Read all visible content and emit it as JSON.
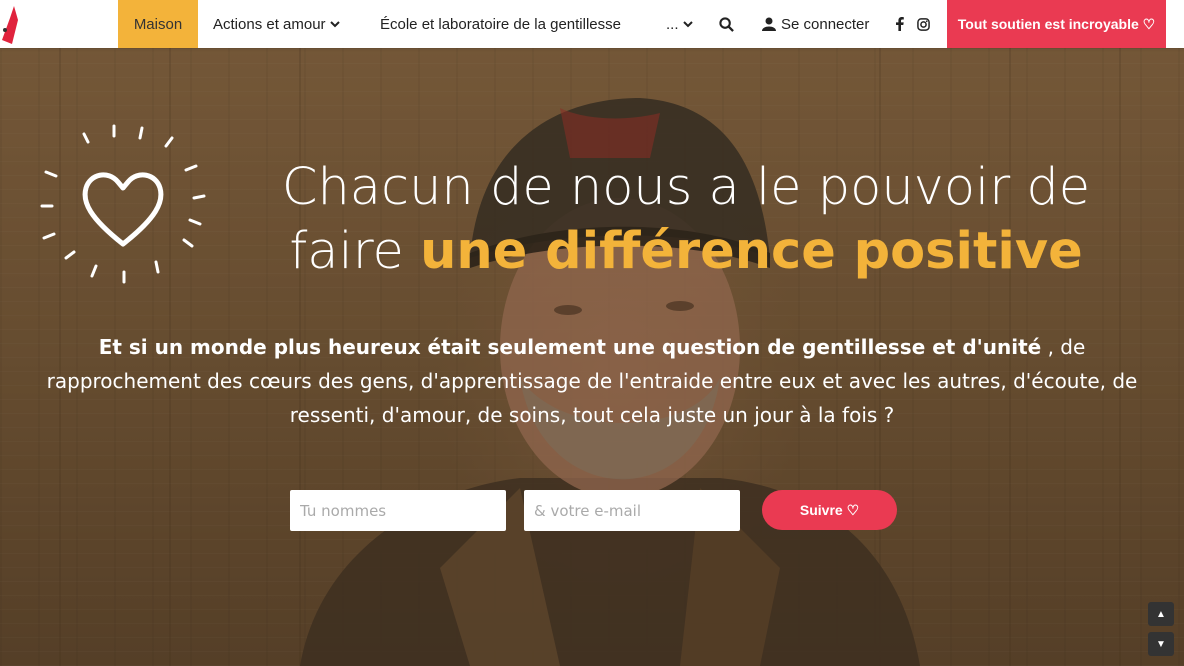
{
  "nav": {
    "items": [
      {
        "label": "Maison"
      },
      {
        "label": "Actions et amour"
      },
      {
        "label": "École et laboratoire de la gentillesse"
      },
      {
        "label": "..."
      }
    ],
    "login_label": "Se connecter",
    "donate_label": "Tout soutien est incroyable ♡",
    "icons": [
      "search-icon",
      "user-icon",
      "facebook-icon",
      "instagram-icon",
      "chevron-down-icon"
    ]
  },
  "hero": {
    "headline_part1": "Chacun de nous a le pouvoir de faire ",
    "headline_highlight": "une différence positive",
    "intro_bold": "Et si un monde plus heureux était seulement une question de gentillesse et d'unité",
    "intro_rest": " , de rapprochement des cœurs des gens, d'apprentissage de l'entraide entre eux et avec les autres, d'écoute, de ressenti, d'amour, de soins, tout cela juste un jour à la fois ?",
    "form": {
      "name_placeholder": "Tu nommes",
      "email_placeholder": "& votre e-mail",
      "submit_label": "Suivre ♡"
    }
  },
  "colors": {
    "accent_yellow": "#f3b33a",
    "accent_red": "#ea3a52"
  },
  "scroll": {
    "up": "▲",
    "down": "▼"
  }
}
